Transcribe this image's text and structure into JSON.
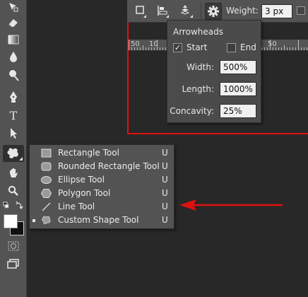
{
  "options_bar": {
    "weight_label": "Weight:",
    "weight_value": "3 px",
    "icons": [
      "fill-square-icon",
      "align-icon",
      "arrange-icon",
      "gear-icon"
    ]
  },
  "ruler": {
    "labels": [
      "50",
      "10",
      "50"
    ]
  },
  "arrowheads_panel": {
    "title": "Arrowheads",
    "start_label": "Start",
    "start_checked": true,
    "end_label": "End",
    "end_checked": false,
    "width_label": "Width:",
    "width_value": "500%",
    "length_label": "Length:",
    "length_value": "1000%",
    "concavity_label": "Concavity:",
    "concavity_value": "25%"
  },
  "flyout": {
    "items": [
      {
        "label": "Rectangle Tool",
        "shortcut": "U",
        "icon": "rectangle-icon",
        "selected": false
      },
      {
        "label": "Rounded Rectangle Tool",
        "shortcut": "U",
        "icon": "rounded-rectangle-icon",
        "selected": false
      },
      {
        "label": "Ellipse Tool",
        "shortcut": "U",
        "icon": "ellipse-icon",
        "selected": false
      },
      {
        "label": "Polygon Tool",
        "shortcut": "U",
        "icon": "polygon-icon",
        "selected": false
      },
      {
        "label": "Line Tool",
        "shortcut": "U",
        "icon": "line-icon",
        "selected": false
      },
      {
        "label": "Custom Shape Tool",
        "shortcut": "U",
        "icon": "custom-shape-icon",
        "selected": true
      }
    ]
  },
  "toolbar": {
    "icons": [
      "move-icon",
      "eraser-icon",
      "gradient-icon",
      "blur-icon",
      "dodge-icon",
      "pen-icon",
      "type-icon",
      "path-selection-icon",
      "custom-shape-tool-icon",
      "hand-icon",
      "zoom-icon",
      "swap-colors-icon",
      "foreground-color-swatch",
      "background-color-swatch",
      "quick-mask-icon",
      "screen-mode-icon"
    ]
  },
  "colors": {
    "highlight": "#e01010",
    "panel_bg": "#535353",
    "canvas_bg": "#282828"
  }
}
